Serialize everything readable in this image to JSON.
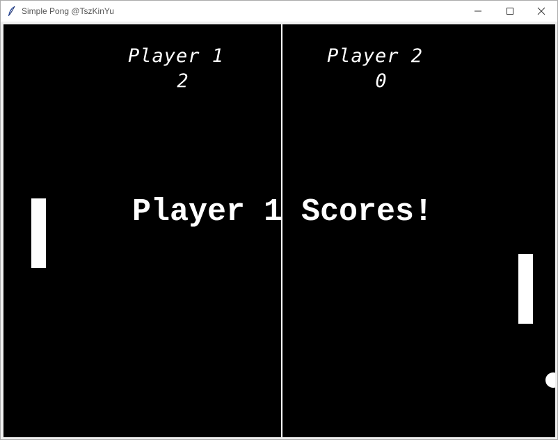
{
  "window": {
    "title": "Simple Pong @TszKinYu",
    "icon": "feather-icon",
    "controls": [
      "minimize-icon",
      "maximize-icon",
      "close-icon"
    ]
  },
  "game": {
    "player1": {
      "label": "Player 1",
      "score": "2"
    },
    "player2": {
      "label": "Player 2",
      "score": "0"
    },
    "message": "Player 1 Scores!"
  },
  "colors": {
    "background": "#000000",
    "foreground": "#ffffff",
    "titlebar": "#ffffff"
  }
}
